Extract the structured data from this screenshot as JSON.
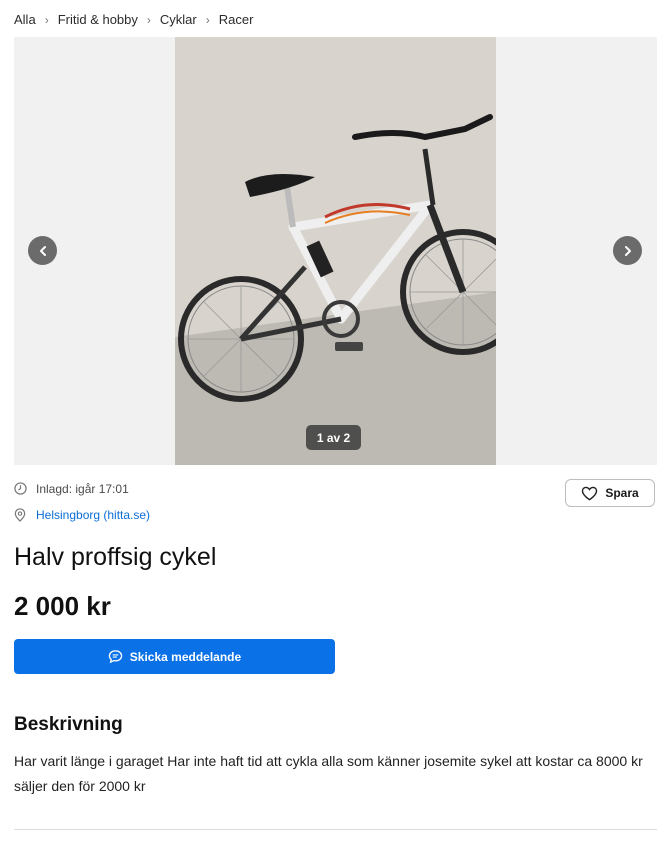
{
  "breadcrumb": [
    "Alla",
    "Fritid & hobby",
    "Cyklar",
    "Racer"
  ],
  "gallery": {
    "counter": "1 av 2",
    "current": 1,
    "total": 2
  },
  "listing": {
    "posted": "Inlagd: igår 17:01",
    "location": "Helsingborg (hitta.se)",
    "save_label": "Spara",
    "title": "Halv proffsig cykel",
    "price": "2 000 kr",
    "message_label": "Skicka meddelande",
    "description_heading": "Beskrivning",
    "description": "Har varit länge i garaget Har inte haft tid att cykla alla som känner josemite sykel att kostar ca 8000 kr säljer den för 2000 kr"
  },
  "colors": {
    "accent": "#0a71e6",
    "link": "#0b6fd6",
    "gallery_bg": "#f1f1f1"
  },
  "icons": [
    "chevron-left-icon",
    "chevron-right-icon",
    "clock-icon",
    "location-pin-icon",
    "heart-icon",
    "chat-bubble-icon"
  ]
}
